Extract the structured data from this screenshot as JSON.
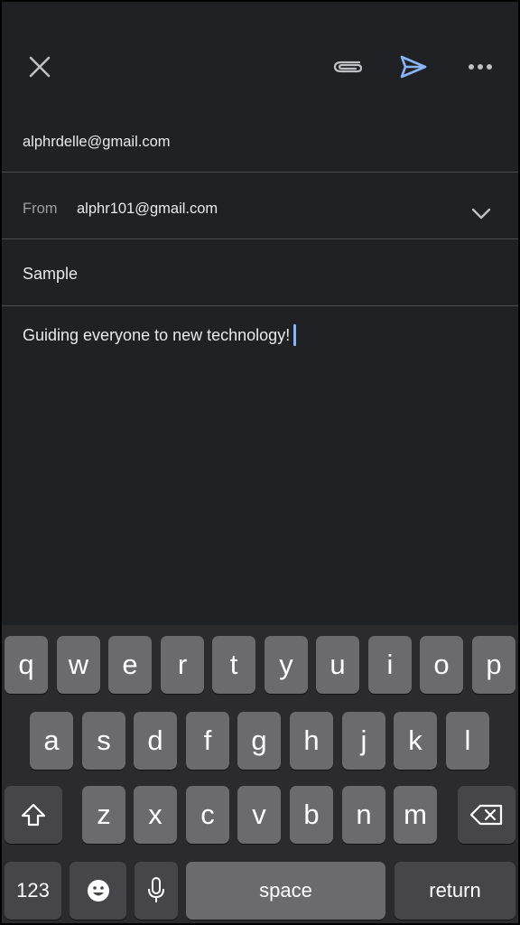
{
  "toolbar": {
    "close_icon": "close-icon",
    "attach_icon": "paperclip-icon",
    "send_icon": "send-icon",
    "more_icon": "more-horizontal-icon",
    "accent_color": "#8ab4f8"
  },
  "compose": {
    "to": "alphrdelle@gmail.com",
    "from_label": "From",
    "from_value": "alphr101@gmail.com",
    "subject": "Sample",
    "body": "Guiding everyone to new technology!"
  },
  "keyboard": {
    "row1": [
      "q",
      "w",
      "e",
      "r",
      "t",
      "y",
      "u",
      "i",
      "o",
      "p"
    ],
    "row2": [
      "a",
      "s",
      "d",
      "f",
      "g",
      "h",
      "j",
      "k",
      "l"
    ],
    "row3": [
      "z",
      "x",
      "c",
      "v",
      "b",
      "n",
      "m"
    ],
    "numbers_label": "123",
    "space_label": "space",
    "return_label": "return"
  }
}
